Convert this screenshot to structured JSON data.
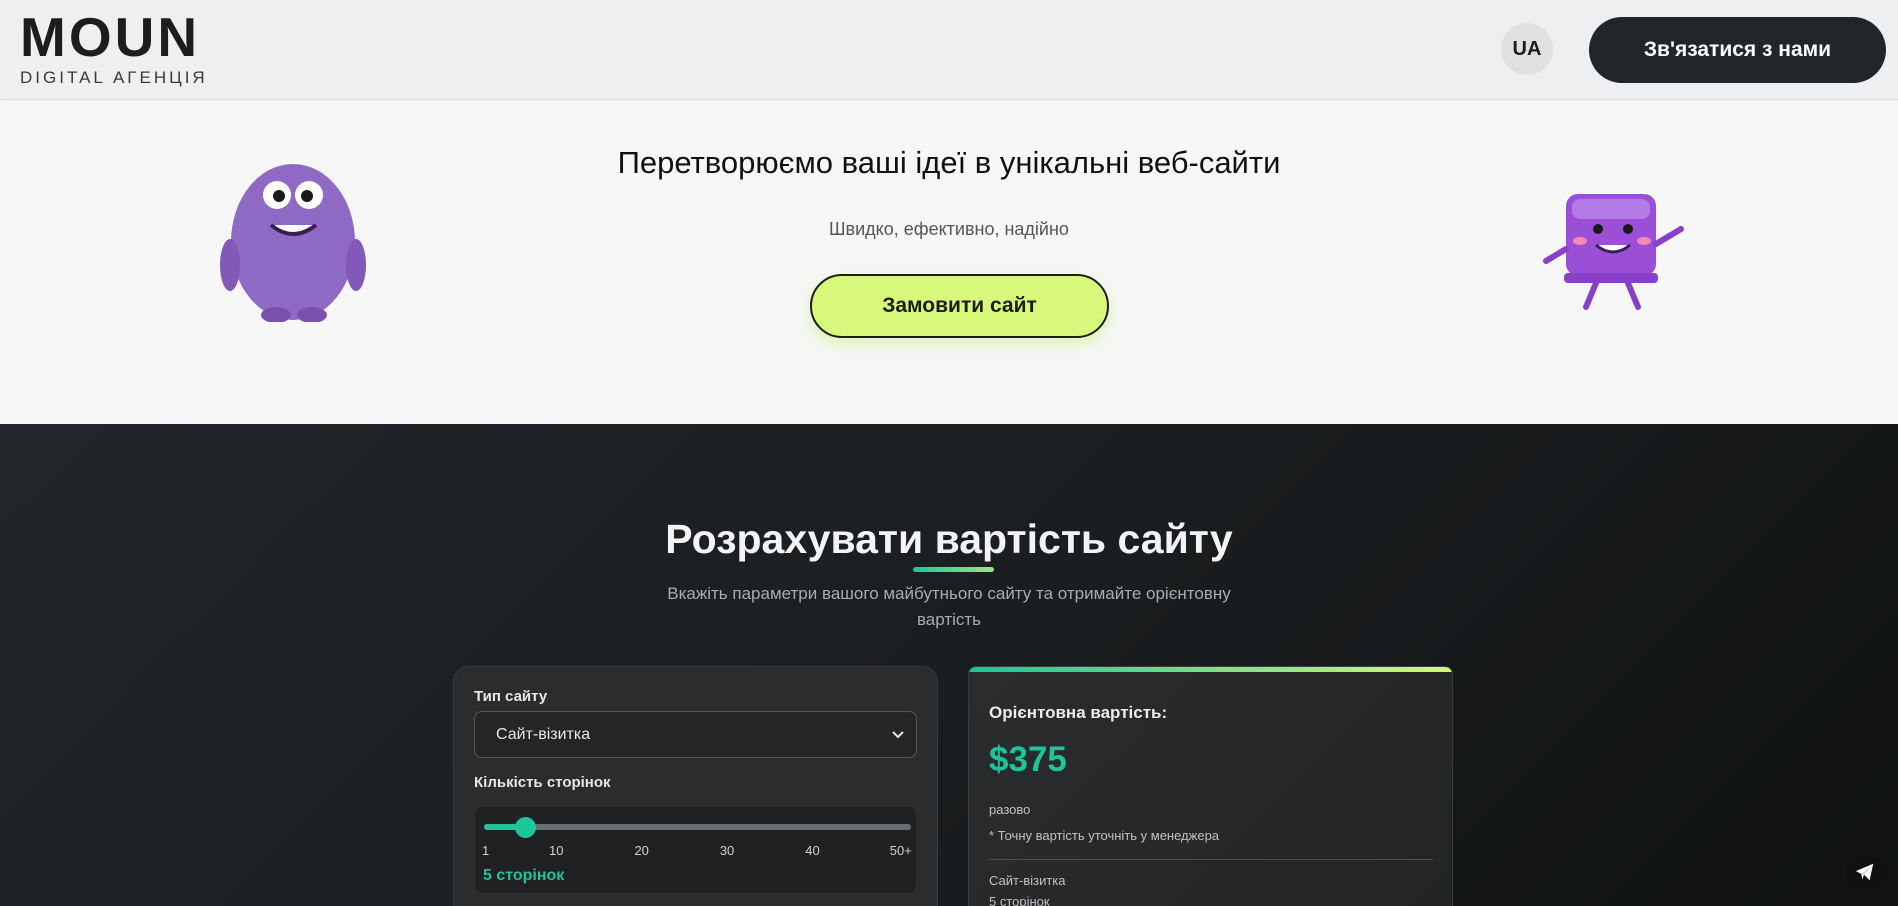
{
  "header": {
    "logo_main": "MOUN",
    "logo_sub": "DIGITAL АГЕНЦІЯ",
    "lang": "UA",
    "contact_label": "Зв'язатися з нами"
  },
  "hero": {
    "title": "Перетворюємо ваші ідеї в унікальні веб-сайти",
    "subtitle": "Швидко, ефективно, надійно",
    "order_label": "Замовити сайт"
  },
  "calculator": {
    "title": "Розрахувати вартість сайту",
    "description": "Вкажіть параметри вашого майбутнього сайту та отримайте орієнтовну вартість",
    "site_type_label": "Тип сайту",
    "site_type_value": "Сайт-візитка",
    "pages_label": "Кількість сторінок",
    "slider_ticks": [
      "1",
      "10",
      "20",
      "30",
      "40",
      "50+"
    ],
    "slider_value": 5,
    "slider_min": 1,
    "slider_max": 50,
    "pages_count_text": "5 сторінок"
  },
  "result": {
    "label": "Орієнтовна вартість:",
    "price": "$375",
    "once": "разово",
    "note": "* Точну вартість уточніть у менеджера",
    "summary_type": "Сайт-візитка",
    "summary_pages": "5 сторінок"
  },
  "colors": {
    "accent_green": "#1ec59a",
    "accent_lime": "#d7f87a",
    "dark_button": "#22262b",
    "mascot_purple": "#8f6ac4"
  },
  "icons": {
    "select_chevron": "chevron-down-icon",
    "telegram": "telegram-icon"
  }
}
